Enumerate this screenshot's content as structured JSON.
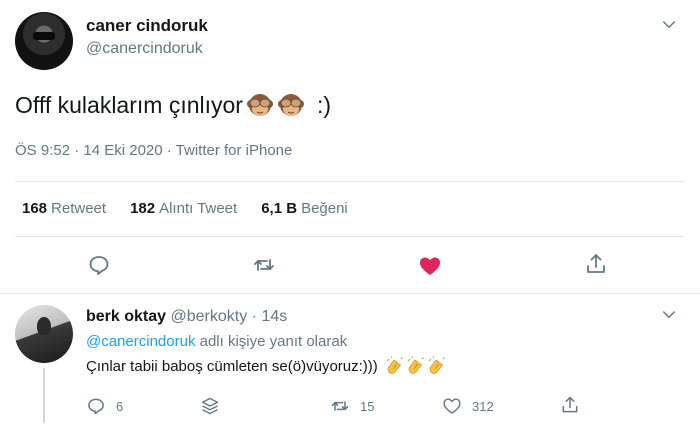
{
  "tweet": {
    "author_name": "caner cindoruk",
    "author_handle": "@canercindoruk",
    "text_main": "Offf kulaklarım çınlıyor",
    "text_tail": ":)",
    "timestamp": "ÖS 9:52 · 14 Eki 2020 · Twitter for iPhone",
    "stats": {
      "retweets": "168",
      "retweets_label": "Retweet",
      "quotes": "182",
      "quotes_label": "Alıntı Tweet",
      "likes": "6,1 B",
      "likes_label": "Beğeni"
    },
    "liked": true,
    "emoji": [
      "see-no-evil-monkey",
      "see-no-evil-monkey"
    ]
  },
  "reply": {
    "author_name": "berk oktay",
    "author_handle": "@berkokty",
    "separator": "·",
    "time": "14s",
    "reply_to_handle": "@canercindoruk",
    "reply_to_suffix": "adlı kişiye yanıt olarak",
    "text": "Çınlar tabii baboş cümleten se(ö)vüyoruz:)))",
    "emoji": [
      "clapping-hands",
      "clapping-hands",
      "clapping-hands"
    ],
    "counts": {
      "replies": "6",
      "retweets": "15",
      "likes": "312"
    }
  },
  "colors": {
    "like_red": "#e0245e",
    "secondary_text": "#657786",
    "link_blue": "#1da1f2",
    "divider": "#e1e8ed"
  }
}
